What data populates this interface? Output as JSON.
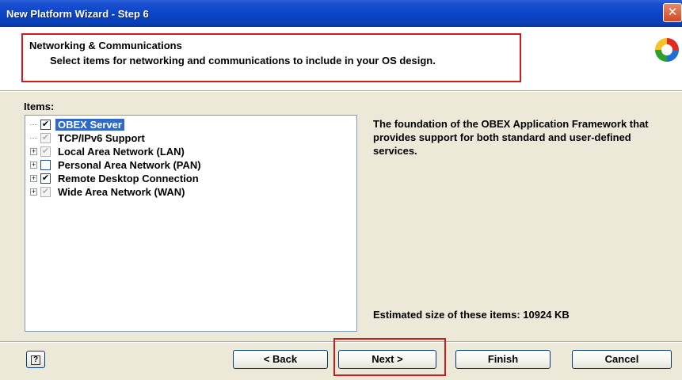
{
  "window": {
    "title": "New Platform Wizard - Step 6",
    "close_label": "✕"
  },
  "header": {
    "title": "Networking & Communications",
    "description": "Select items for networking and communications to include in your OS design."
  },
  "items_label": "Items:",
  "tree": {
    "items": [
      {
        "label": "OBEX Server",
        "checked": "✔",
        "state": "checked",
        "selected": true,
        "expandable": false
      },
      {
        "label": "TCP/IPv6 Support",
        "checked": "✔",
        "state": "checked",
        "selected": false,
        "expandable": false
      },
      {
        "label": "Local Area Network (LAN)",
        "checked": "✔",
        "state": "partial",
        "selected": false,
        "expandable": true
      },
      {
        "label": "Personal Area Network (PAN)",
        "checked": "",
        "state": "unchecked",
        "selected": false,
        "expandable": true
      },
      {
        "label": "Remote Desktop Connection",
        "checked": "✔",
        "state": "checked",
        "selected": false,
        "expandable": true
      },
      {
        "label": "Wide Area Network (WAN)",
        "checked": "✔",
        "state": "partial",
        "selected": false,
        "expandable": true
      }
    ],
    "expander_glyph": "+"
  },
  "description": "The foundation of the OBEX Application Framework that provides support for both standard and user-defined services.",
  "size_text": "Estimated size of these items: 10924 KB",
  "buttons": {
    "help": "?",
    "back": "< Back",
    "next": "Next >",
    "finish": "Finish",
    "cancel": "Cancel"
  },
  "colors": {
    "titlebar": "#0b45c8",
    "highlight": "#d11a1a",
    "selection": "#316ac5",
    "dialog_bg": "#ece9d8"
  }
}
